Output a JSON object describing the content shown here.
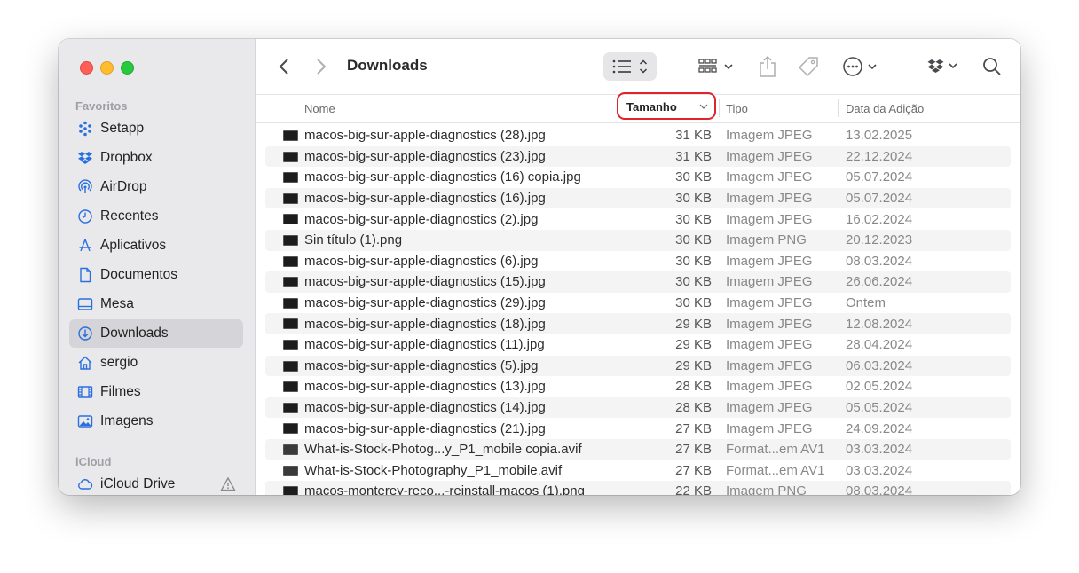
{
  "sidebar": {
    "favorites_title": "Favoritos",
    "items": [
      {
        "label": "Setapp",
        "icon": "setapp-icon"
      },
      {
        "label": "Dropbox",
        "icon": "dropbox-icon"
      },
      {
        "label": "AirDrop",
        "icon": "airdrop-icon"
      },
      {
        "label": "Recentes",
        "icon": "clock-icon"
      },
      {
        "label": "Aplicativos",
        "icon": "applications-icon"
      },
      {
        "label": "Documentos",
        "icon": "document-icon"
      },
      {
        "label": "Mesa",
        "icon": "desktop-icon"
      },
      {
        "label": "Downloads",
        "icon": "downloads-icon",
        "selected": true
      },
      {
        "label": "sergio",
        "icon": "home-icon"
      },
      {
        "label": "Filmes",
        "icon": "film-icon"
      },
      {
        "label": "Imagens",
        "icon": "photo-icon"
      }
    ],
    "icloud_title": "iCloud",
    "icloud_items": [
      {
        "label": "iCloud Drive",
        "icon": "cloud-icon",
        "warning": true
      }
    ]
  },
  "toolbar": {
    "title": "Downloads",
    "icons": [
      "back-icon",
      "forward-icon",
      "list-view-icon",
      "group-icon",
      "share-icon",
      "tag-icon",
      "more-icon",
      "dropbox-icon",
      "search-icon"
    ]
  },
  "columns": {
    "name": "Nome",
    "size": "Tamanho",
    "type": "Tipo",
    "date": "Data da Adição"
  },
  "accent_color": "#e0242c",
  "files": [
    {
      "name": "macos-big-sur-apple-diagnostics (28).jpg",
      "size": "31 KB",
      "type": "Imagem JPEG",
      "date": "13.02.2025"
    },
    {
      "name": "macos-big-sur-apple-diagnostics (23).jpg",
      "size": "31 KB",
      "type": "Imagem JPEG",
      "date": "22.12.2024"
    },
    {
      "name": "macos-big-sur-apple-diagnostics (16) copia.jpg",
      "size": "30 KB",
      "type": "Imagem JPEG",
      "date": "05.07.2024"
    },
    {
      "name": "macos-big-sur-apple-diagnostics (16).jpg",
      "size": "30 KB",
      "type": "Imagem JPEG",
      "date": "05.07.2024"
    },
    {
      "name": "macos-big-sur-apple-diagnostics (2).jpg",
      "size": "30 KB",
      "type": "Imagem JPEG",
      "date": "16.02.2024"
    },
    {
      "name": "Sin título (1).png",
      "size": "30 KB",
      "type": "Imagem PNG",
      "date": "20.12.2023"
    },
    {
      "name": "macos-big-sur-apple-diagnostics (6).jpg",
      "size": "30 KB",
      "type": "Imagem JPEG",
      "date": "08.03.2024"
    },
    {
      "name": "macos-big-sur-apple-diagnostics (15).jpg",
      "size": "30 KB",
      "type": "Imagem JPEG",
      "date": "26.06.2024"
    },
    {
      "name": "macos-big-sur-apple-diagnostics (29).jpg",
      "size": "30 KB",
      "type": "Imagem JPEG",
      "date": "Ontem"
    },
    {
      "name": "macos-big-sur-apple-diagnostics (18).jpg",
      "size": "29 KB",
      "type": "Imagem JPEG",
      "date": "12.08.2024"
    },
    {
      "name": "macos-big-sur-apple-diagnostics (11).jpg",
      "size": "29 KB",
      "type": "Imagem JPEG",
      "date": "28.04.2024"
    },
    {
      "name": "macos-big-sur-apple-diagnostics (5).jpg",
      "size": "29 KB",
      "type": "Imagem JPEG",
      "date": "06.03.2024"
    },
    {
      "name": "macos-big-sur-apple-diagnostics (13).jpg",
      "size": "28 KB",
      "type": "Imagem JPEG",
      "date": "02.05.2024"
    },
    {
      "name": "macos-big-sur-apple-diagnostics (14).jpg",
      "size": "28 KB",
      "type": "Imagem JPEG",
      "date": "05.05.2024"
    },
    {
      "name": "macos-big-sur-apple-diagnostics (21).jpg",
      "size": "27 KB",
      "type": "Imagem JPEG",
      "date": "24.09.2024"
    },
    {
      "name": "What-is-Stock-Photog...y_P1_mobile copia.avif",
      "size": "27 KB",
      "type": "Format...em AV1",
      "date": "03.03.2024"
    },
    {
      "name": "What-is-Stock-Photography_P1_mobile.avif",
      "size": "27 KB",
      "type": "Format...em AV1",
      "date": "03.03.2024"
    },
    {
      "name": "macos-monterey-reco...-reinstall-macos (1).png",
      "size": "22 KB",
      "type": "Imagem PNG",
      "date": "08.03.2024"
    }
  ]
}
